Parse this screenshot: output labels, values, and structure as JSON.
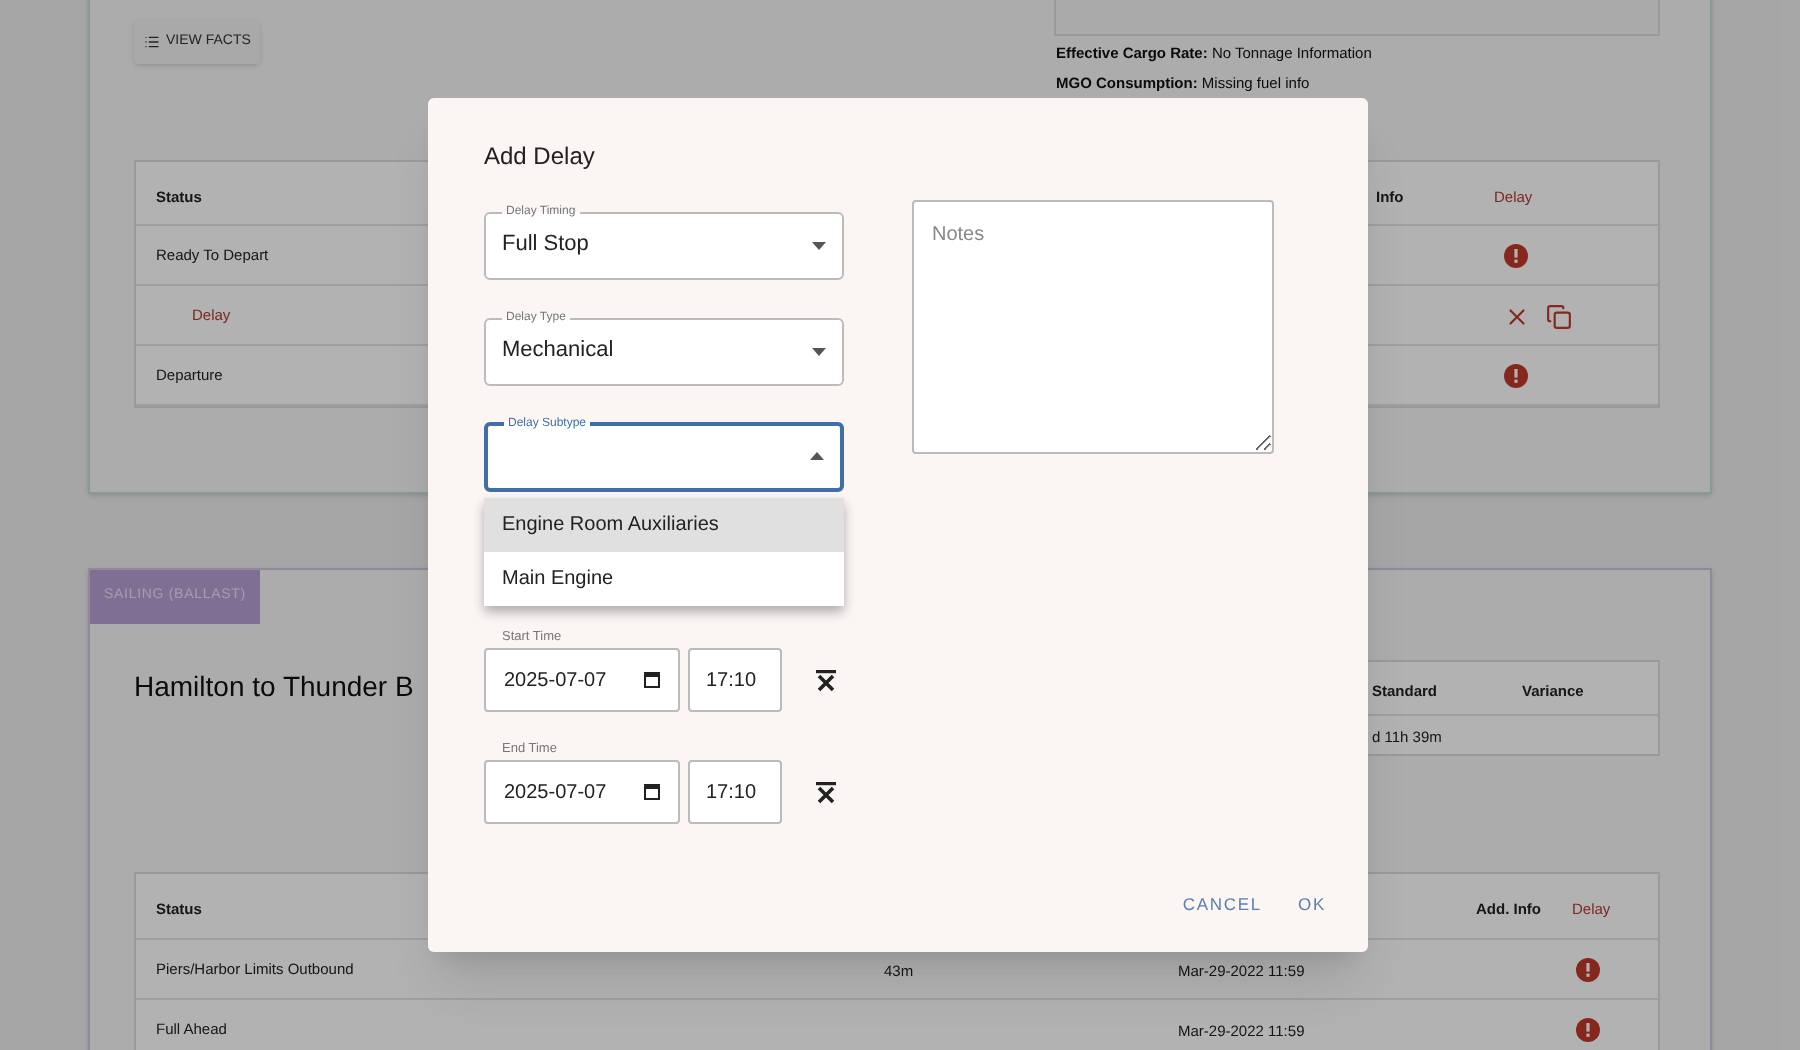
{
  "voyage_card": {
    "view_facts_button": "VIEW FACTS",
    "facts": [
      {
        "label": "Effective Cargo Rate:",
        "value": "No Tonnage Information"
      },
      {
        "label": "MGO Consumption:",
        "value": "Missing fuel info"
      }
    ],
    "table": {
      "columns": [
        "Status",
        "Info",
        "Delay"
      ],
      "rows": [
        {
          "kind": "event",
          "status": "Ready To Depart"
        },
        {
          "kind": "delay",
          "status": "Delay"
        },
        {
          "kind": "event",
          "status": "Departure"
        }
      ]
    }
  },
  "leg_card": {
    "badge": "SAILING (BALLAST)",
    "title": "Hamilton to Thunder B",
    "summary": {
      "columns": [
        "Standard",
        "Variance"
      ],
      "cell": "d 11h 39m"
    },
    "table": {
      "columns": [
        "Status",
        "Add. Info",
        "Delay"
      ],
      "rows": [
        {
          "kind": "event",
          "status": "Piers/Harbor Limits Outbound",
          "duration": "43m",
          "time": "Mar-29-2022 11:59"
        },
        {
          "kind": "event",
          "status": "Full Ahead",
          "time": "Mar-29-2022 11:59"
        }
      ]
    }
  },
  "dialog": {
    "title": "Add Delay",
    "selects": [
      {
        "label": "Delay Timing",
        "value": "Full Stop",
        "expanded": false
      },
      {
        "label": "Delay Type",
        "value": "Mechanical",
        "expanded": false
      },
      {
        "label": "Delay Subtype",
        "expanded": true,
        "options": [
          {
            "label": "Engine Room Auxiliaries",
            "selected": true
          },
          {
            "label": "Main Engine",
            "selected": false
          }
        ]
      }
    ],
    "notes": {
      "placeholder": "Notes"
    },
    "times": [
      {
        "label": "Start Time",
        "date": "2025-07-07",
        "time": "17:10"
      },
      {
        "label": "End Time",
        "date": "2025-07-07",
        "time": "17:10"
      }
    ],
    "buttons": [
      "CANCEL",
      "OK"
    ]
  }
}
